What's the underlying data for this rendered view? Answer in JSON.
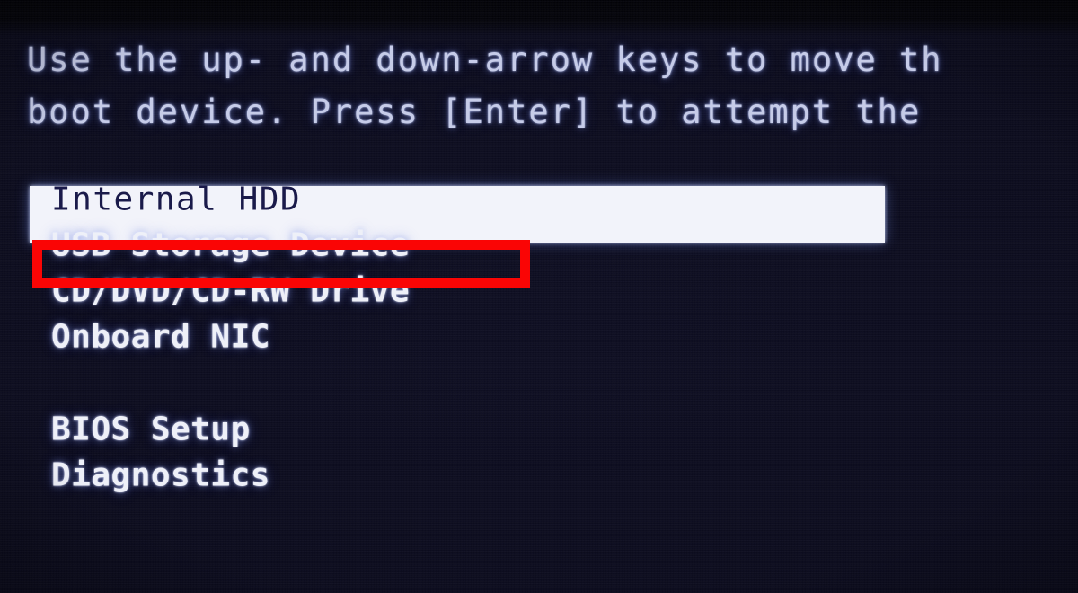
{
  "screen": {
    "kind": "bios-boot-device-menu",
    "background_color": "#0a0a1a",
    "text_color": "#c5cbe8",
    "item_color": "#eef0f8"
  },
  "header": {
    "line1": "Use the up- and down-arrow keys to move th",
    "line2": "boot device. Press [Enter] to attempt the"
  },
  "menu": {
    "items": [
      {
        "label": "Internal HDD",
        "selected": true
      },
      {
        "label": "USB Storage Device",
        "selected": false
      },
      {
        "label": "CD/DVD/CD-RW Drive",
        "selected": false
      },
      {
        "label": "Onboard NIC",
        "selected": false
      }
    ],
    "options": [
      {
        "label": "BIOS Setup",
        "selected": false
      },
      {
        "label": "Diagnostics",
        "selected": false
      }
    ],
    "highlight_bg": "#f2f3fa",
    "highlight_fg": "#1a1a4a"
  },
  "annotation": {
    "target": "USB Storage Device",
    "color": "#fa0505",
    "stroke_width": 11
  }
}
